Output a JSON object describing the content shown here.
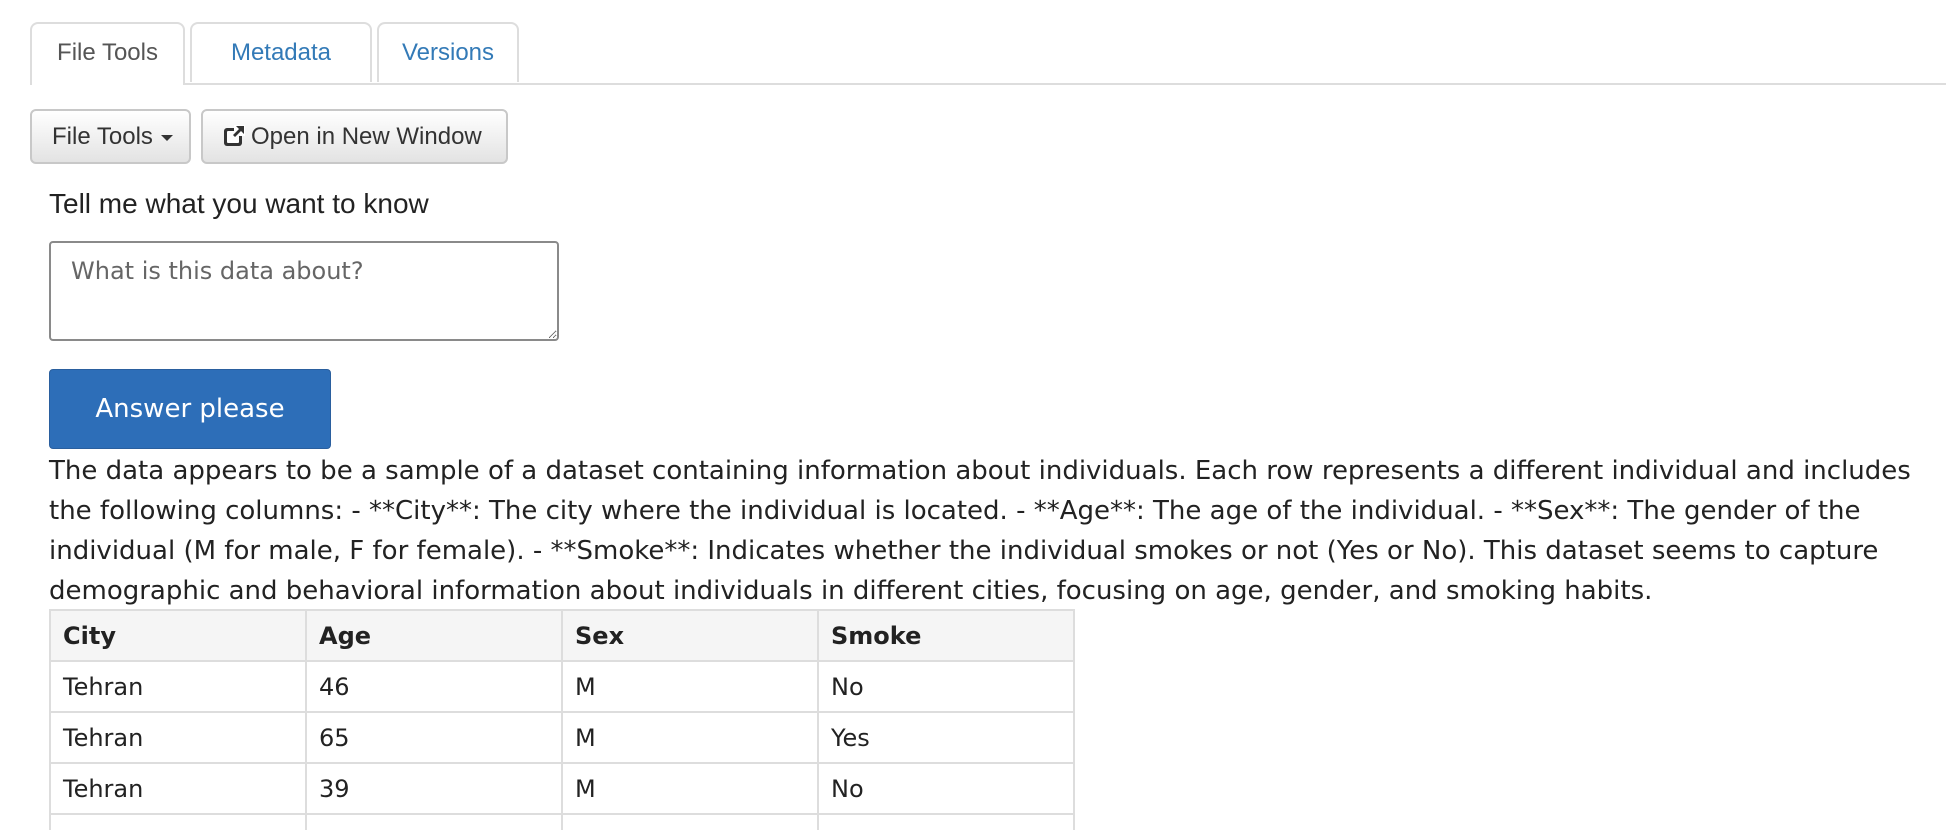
{
  "tabs": [
    {
      "label": "File Tools",
      "active": true
    },
    {
      "label": "Metadata",
      "active": false
    },
    {
      "label": "Versions",
      "active": false
    }
  ],
  "toolbar": {
    "file_tools_label": "File Tools",
    "open_new_window_label": "Open in New Window"
  },
  "question": {
    "label": "Tell me what you want to know",
    "placeholder": "What is this data about?",
    "submit_label": "Answer please"
  },
  "answer": {
    "text": "The data appears to be a sample of a dataset containing information about individuals. Each row represents a different individual and includes the following columns: - **City**: The city where the individual is located. - **Age**: The age of the individual. - **Sex**: The gender of the individual (M for male, F for female). - **Smoke**: Indicates whether the individual smokes or not (Yes or No). This dataset seems to capture demographic and behavioral information about individuals in different cities, focusing on age, gender, and smoking habits."
  },
  "table": {
    "headers": [
      "City",
      "Age",
      "Sex",
      "Smoke"
    ],
    "rows": [
      [
        "Tehran",
        "46",
        "M",
        "No"
      ],
      [
        "Tehran",
        "65",
        "M",
        "Yes"
      ],
      [
        "Tehran",
        "39",
        "M",
        "No"
      ]
    ]
  },
  "colors": {
    "link": "#337ab7",
    "primary_button": "#2d6eb8",
    "tab_border": "#dddddd"
  },
  "icons": {
    "dropdown": "caret-down-icon",
    "open_window": "external-link-icon"
  }
}
